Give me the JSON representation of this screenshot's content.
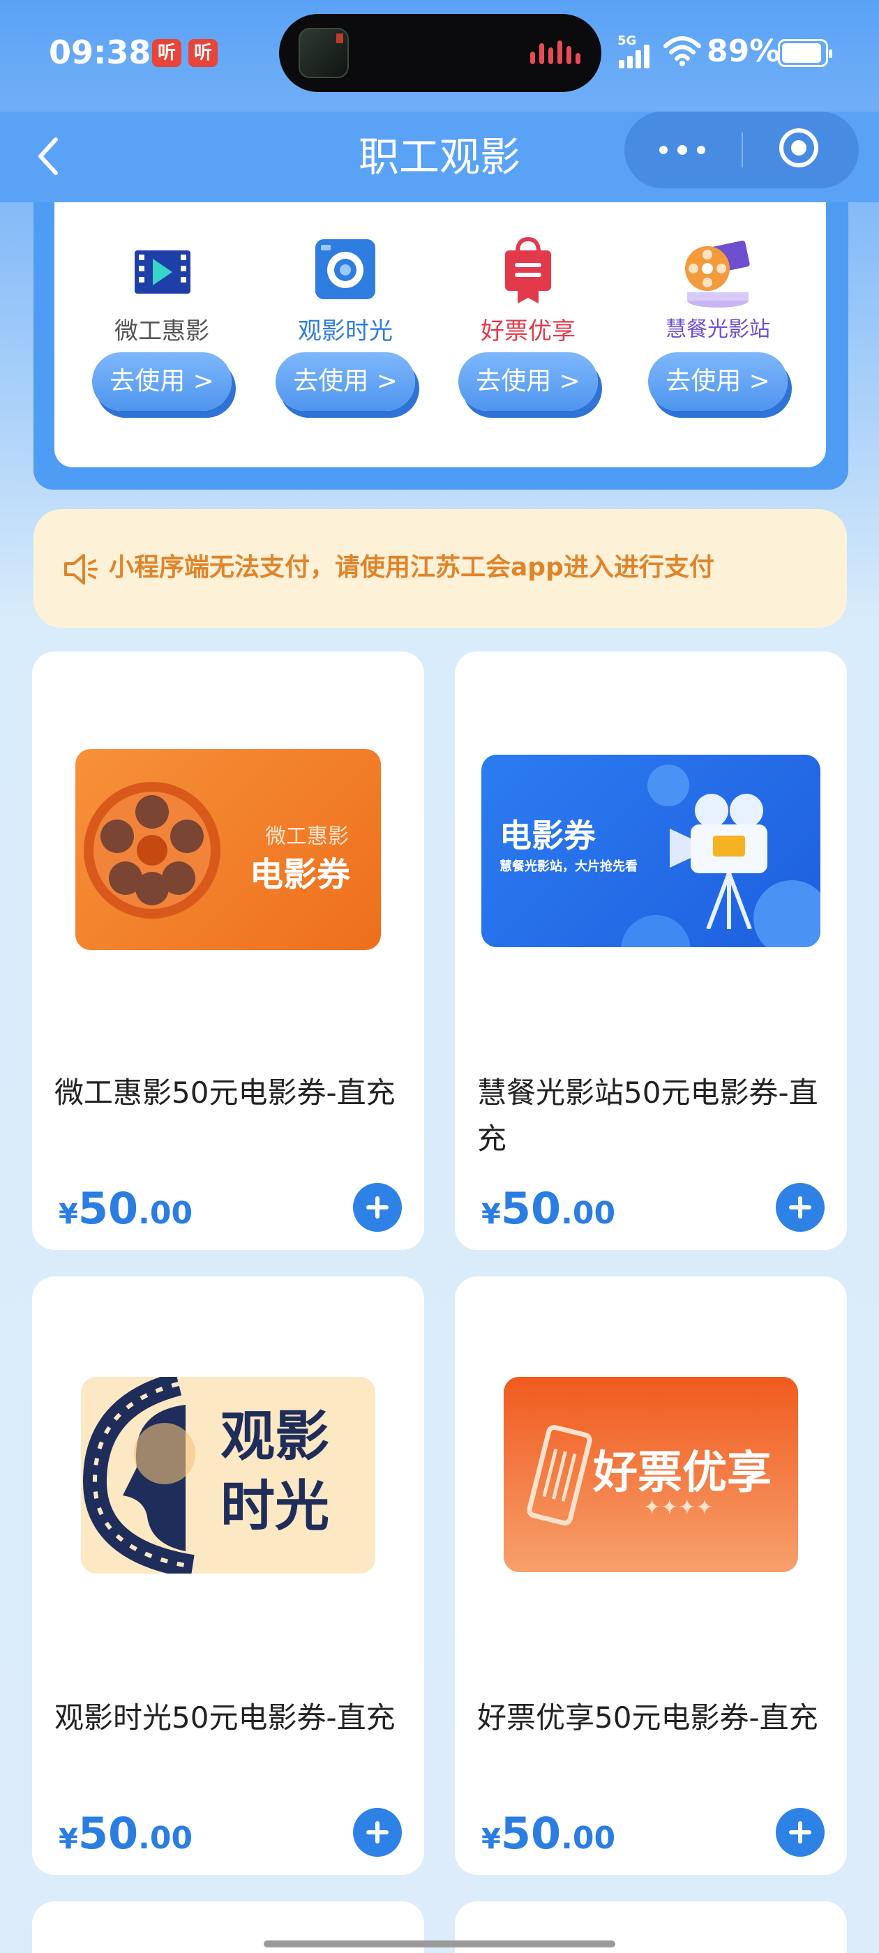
{
  "status_bar": {
    "time": "09:38",
    "badge1": "听",
    "badge2": "听",
    "network": "5G",
    "battery": "89%"
  },
  "nav": {
    "title": "职工观影"
  },
  "channels": [
    {
      "name": "微工惠影",
      "button": "去使用 >",
      "color": "#555555"
    },
    {
      "name": "观影时光",
      "button": "去使用 >",
      "color": "#2f7de0"
    },
    {
      "name": "好票优享",
      "button": "去使用 >",
      "color": "#e23a4a"
    },
    {
      "name": "慧餐光影站",
      "button": "去使用 >",
      "color": "#6e4fd0"
    }
  ],
  "notice": {
    "text": "小程序端无法支付，请使用江苏工会app进入进行支付"
  },
  "products": [
    {
      "title": "微工惠影50元电影券-直充",
      "price_symbol": "¥",
      "price_int": "50",
      "price_dec": ".00",
      "image": {
        "brand": "微工惠影",
        "label": "电影券"
      }
    },
    {
      "title": "慧餐光影站50元电影券-直充",
      "price_symbol": "¥",
      "price_int": "50",
      "price_dec": ".00",
      "image": {
        "label": "电影券",
        "tagline": "慧餐光影站，大片抢先看"
      }
    },
    {
      "title": "观影时光50元电影券-直充",
      "price_symbol": "¥",
      "price_int": "50",
      "price_dec": ".00",
      "image": {
        "line1": "观影",
        "line2": "时光"
      }
    },
    {
      "title": "好票优享50元电影券-直充",
      "price_symbol": "¥",
      "price_int": "50",
      "price_dec": ".00",
      "image": {
        "label": "好票优享",
        "deco": "✦✦✦✦"
      }
    }
  ],
  "colors": {
    "primary": "#5aa2f6",
    "price": "#2a7de1",
    "notice_text": "#e0842a",
    "notice_bg": "#fdf1d8"
  }
}
